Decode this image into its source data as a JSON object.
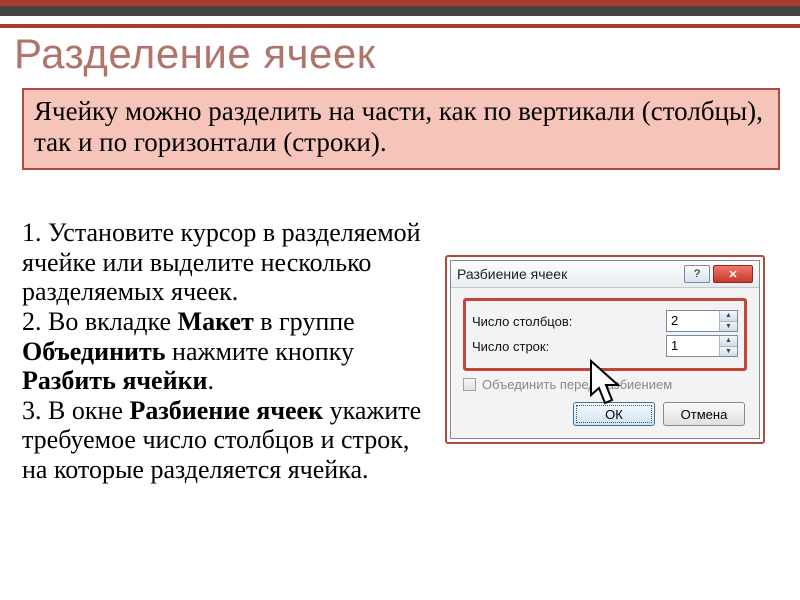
{
  "slide": {
    "title": "Разделение ячеек",
    "intro": "Ячейку можно разделить на части, как по вертикали (столбцы), так и по горизонтали (строки).",
    "step1": "1. Установите курсор в разделяемой ячейке или выделите несколько разделяемых ячеек.",
    "step2_pre": "2. Во вкладке ",
    "step2_tab": "Макет",
    "step2_mid": " в группе ",
    "step2_group": "Объединить",
    "step2_mid2": " нажмите кнопку ",
    "step2_btn": "Разбить ячейки",
    "step2_end": ".",
    "step3_pre": "3. В окне ",
    "step3_win": "Разбиение ячеек",
    "step3_end": "  укажите требуемое число столбцов и строк, на которые разделяется ячейка."
  },
  "dialog": {
    "title": "Разбиение ячеек",
    "cols_label": "Число столбцов:",
    "cols_value": "2",
    "rows_label": "Число строк:",
    "rows_value": "1",
    "merge_label": "Объединить перед разбиением",
    "ok": "ОК",
    "cancel": "Отмена"
  }
}
